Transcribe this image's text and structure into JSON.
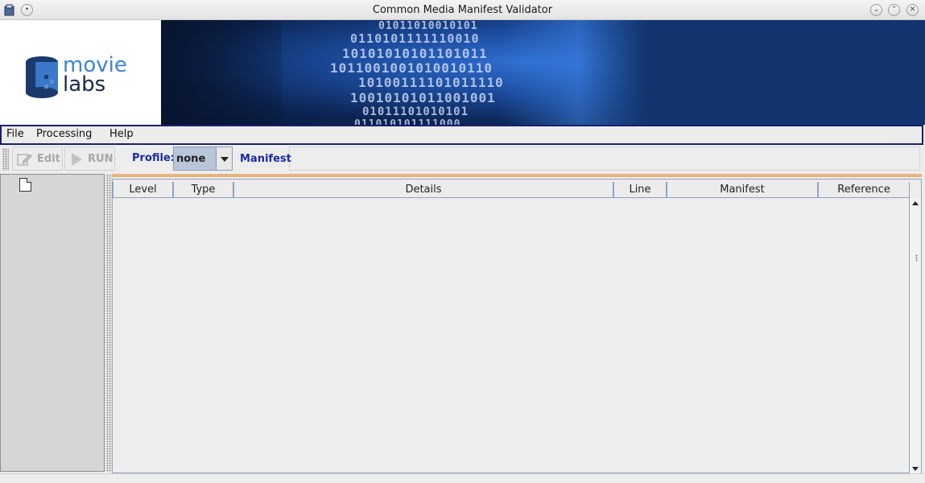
{
  "window": {
    "title": "Common Media Manifest Validator"
  },
  "banner": {
    "logo_line1": "movie",
    "logo_line2": "labs",
    "binary_rows": [
      "01011010010101",
      "0110101111110010",
      "10101010101101011",
      "1011001001010010110",
      "10100111101011110",
      "10010101011001001",
      "01011101010101",
      "011010101111000"
    ]
  },
  "menu": {
    "items": [
      "File",
      "Processing",
      "Help"
    ]
  },
  "toolbar": {
    "edit_label": "Edit",
    "run_label": "RUN",
    "profile_label": "Profile:",
    "profile_value": "none",
    "manifest_label": "Manifest"
  },
  "table": {
    "columns": [
      "Level",
      "Type",
      "Details",
      "Line",
      "Manifest",
      "Reference"
    ],
    "rows": []
  },
  "colors": {
    "menubar_border": "#1a1f6e",
    "accent_text": "#1b2aa8",
    "banner_blue": "#12356f",
    "table_top_rule": "#e7b37f"
  }
}
